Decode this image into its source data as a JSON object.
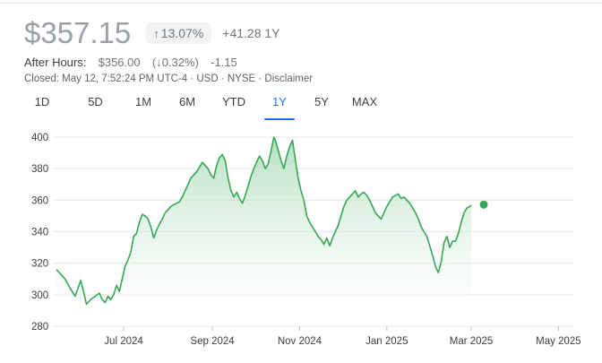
{
  "quote": {
    "price": "$357.15",
    "change_pct": "13.07%",
    "change_abs": "+41.28 1Y",
    "after_hours_label": "After Hours:",
    "after_hours_price": "$356.00",
    "after_hours_pct": "(↓0.32%)",
    "after_hours_change": "-1.15",
    "closed_info": "Closed: May 12, 7:52:24 PM UTC-4 · USD · NYSE · Disclaimer",
    "up_icon": "arrow-up-icon",
    "down_icon": "arrow-down-icon"
  },
  "ranges": [
    "1D",
    "5D",
    "1M",
    "6M",
    "YTD",
    "1Y",
    "5Y",
    "MAX"
  ],
  "active_range": "1Y",
  "colors": {
    "line": "#34a853",
    "fill_top": "#a8dab5",
    "grid": "#e8eaed",
    "axis_text": "#3c4043",
    "active_tab": "#1a73e8"
  },
  "chart_data": {
    "type": "area",
    "title": "",
    "xlabel": "",
    "ylabel": "",
    "ylim": [
      280,
      400
    ],
    "yticks": [
      280,
      300,
      320,
      340,
      360,
      380,
      400
    ],
    "xticks": [
      {
        "label": "Jul 2024",
        "day": 47
      },
      {
        "label": "Sep 2024",
        "day": 109
      },
      {
        "label": "Nov 2024",
        "day": 170
      },
      {
        "label": "Jan 2025",
        "day": 231
      },
      {
        "label": "Mar 2025",
        "day": 290
      },
      {
        "label": "May 2025",
        "day": 351
      }
    ],
    "x_start": "2024-05-15",
    "x_end": "2025-05-12",
    "series": [
      {
        "values": [
          [
            0,
            316
          ],
          [
            3,
            313
          ],
          [
            6,
            310
          ],
          [
            9,
            305
          ],
          [
            11,
            302
          ],
          [
            13,
            299
          ],
          [
            15,
            304
          ],
          [
            17,
            309
          ],
          [
            19,
            302
          ],
          [
            21,
            294
          ],
          [
            24,
            297
          ],
          [
            27,
            299
          ],
          [
            30,
            301
          ],
          [
            32,
            297
          ],
          [
            34,
            295
          ],
          [
            36,
            299
          ],
          [
            38,
            297
          ],
          [
            40,
            300
          ],
          [
            42,
            306
          ],
          [
            44,
            302
          ],
          [
            46,
            310
          ],
          [
            48,
            318
          ],
          [
            50,
            322
          ],
          [
            52,
            327
          ],
          [
            54,
            337
          ],
          [
            56,
            339
          ],
          [
            58,
            346
          ],
          [
            60,
            351
          ],
          [
            62,
            350
          ],
          [
            64,
            348
          ],
          [
            66,
            343
          ],
          [
            68,
            336
          ],
          [
            70,
            341
          ],
          [
            72,
            345
          ],
          [
            74,
            348
          ],
          [
            76,
            352
          ],
          [
            78,
            354
          ],
          [
            80,
            356
          ],
          [
            82,
            357
          ],
          [
            84,
            358
          ],
          [
            86,
            359
          ],
          [
            88,
            362
          ],
          [
            90,
            366
          ],
          [
            92,
            370
          ],
          [
            94,
            374
          ],
          [
            96,
            376
          ],
          [
            98,
            378
          ],
          [
            100,
            381
          ],
          [
            102,
            384
          ],
          [
            104,
            382
          ],
          [
            106,
            380
          ],
          [
            108,
            376
          ],
          [
            110,
            374
          ],
          [
            112,
            382
          ],
          [
            114,
            387
          ],
          [
            116,
            389
          ],
          [
            118,
            385
          ],
          [
            120,
            374
          ],
          [
            122,
            366
          ],
          [
            124,
            362
          ],
          [
            126,
            365
          ],
          [
            128,
            361
          ],
          [
            130,
            358
          ],
          [
            132,
            363
          ],
          [
            134,
            369
          ],
          [
            136,
            375
          ],
          [
            138,
            380
          ],
          [
            140,
            384
          ],
          [
            142,
            388
          ],
          [
            144,
            385
          ],
          [
            146,
            380
          ],
          [
            148,
            383
          ],
          [
            150,
            391
          ],
          [
            152,
            400
          ],
          [
            153,
            398
          ],
          [
            155,
            392
          ],
          [
            157,
            385
          ],
          [
            159,
            380
          ],
          [
            161,
            388
          ],
          [
            163,
            394
          ],
          [
            165,
            398
          ],
          [
            167,
            386
          ],
          [
            169,
            374
          ],
          [
            171,
            366
          ],
          [
            173,
            360
          ],
          [
            175,
            350
          ],
          [
            177,
            346
          ],
          [
            179,
            343
          ],
          [
            181,
            340
          ],
          [
            183,
            337
          ],
          [
            185,
            335
          ],
          [
            187,
            332
          ],
          [
            189,
            336
          ],
          [
            191,
            331
          ],
          [
            193,
            336
          ],
          [
            195,
            340
          ],
          [
            197,
            344
          ],
          [
            199,
            350
          ],
          [
            201,
            356
          ],
          [
            203,
            360
          ],
          [
            205,
            362
          ],
          [
            207,
            364
          ],
          [
            209,
            366
          ],
          [
            211,
            362
          ],
          [
            213,
            364
          ],
          [
            215,
            365
          ],
          [
            217,
            363
          ],
          [
            219,
            360
          ],
          [
            221,
            356
          ],
          [
            223,
            352
          ],
          [
            225,
            350
          ],
          [
            227,
            348
          ],
          [
            229,
            352
          ],
          [
            231,
            356
          ],
          [
            233,
            359
          ],
          [
            235,
            362
          ],
          [
            237,
            363
          ],
          [
            239,
            364
          ],
          [
            241,
            361
          ],
          [
            243,
            362
          ],
          [
            245,
            360
          ],
          [
            247,
            358
          ],
          [
            249,
            355
          ],
          [
            251,
            352
          ],
          [
            253,
            348
          ],
          [
            255,
            343
          ],
          [
            257,
            340
          ],
          [
            259,
            337
          ],
          [
            261,
            331
          ],
          [
            263,
            325
          ],
          [
            265,
            318
          ],
          [
            267,
            314
          ],
          [
            269,
            321
          ],
          [
            271,
            333
          ],
          [
            273,
            337
          ],
          [
            275,
            330
          ],
          [
            277,
            334
          ],
          [
            279,
            334
          ],
          [
            281,
            339
          ],
          [
            283,
            346
          ],
          [
            285,
            352
          ],
          [
            287,
            355
          ],
          [
            289,
            356
          ],
          [
            290,
            357
          ]
        ],
        "last_value": 357.15
      }
    ]
  }
}
